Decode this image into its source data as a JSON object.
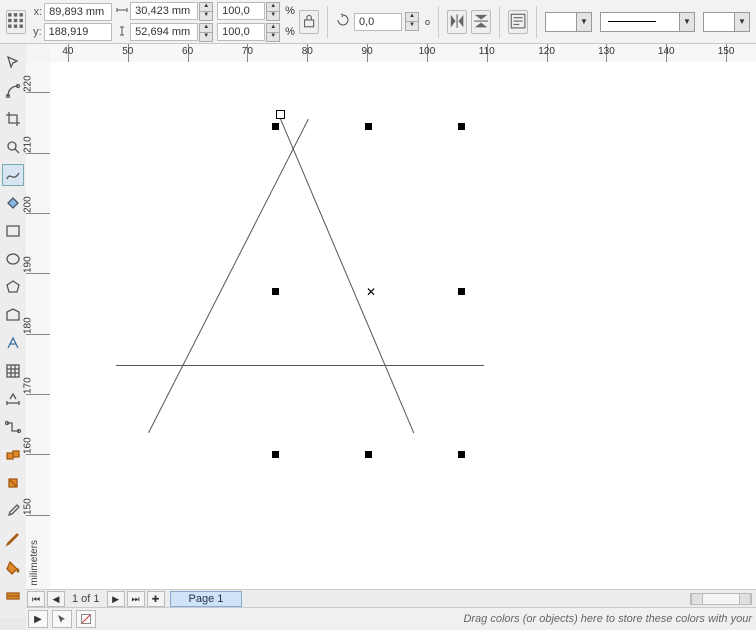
{
  "coords": {
    "x_label": "x:",
    "x_value": "89,893 mm",
    "y_label": "y:",
    "y_value": "188,919 mm",
    "w_value": "30,423 mm",
    "h_value": "52,694 mm",
    "scale_x": "100,0",
    "scale_y": "100,0",
    "scale_unit": "%",
    "rotation": "0,0",
    "rot_unit": "o"
  },
  "hruler_ticks": [
    40,
    50,
    60,
    70,
    80,
    90,
    100,
    110,
    120,
    130,
    140,
    150
  ],
  "vruler_ticks": [
    220,
    210,
    200,
    190,
    180,
    170,
    160,
    150
  ],
  "vruler_unit": "milimeters",
  "pager": {
    "count": "1 of 1",
    "tab": "Page 1"
  },
  "status": {
    "hint": "Drag colors (or objects) here to store these colors with your"
  },
  "linestyle": {
    "empty": ""
  }
}
